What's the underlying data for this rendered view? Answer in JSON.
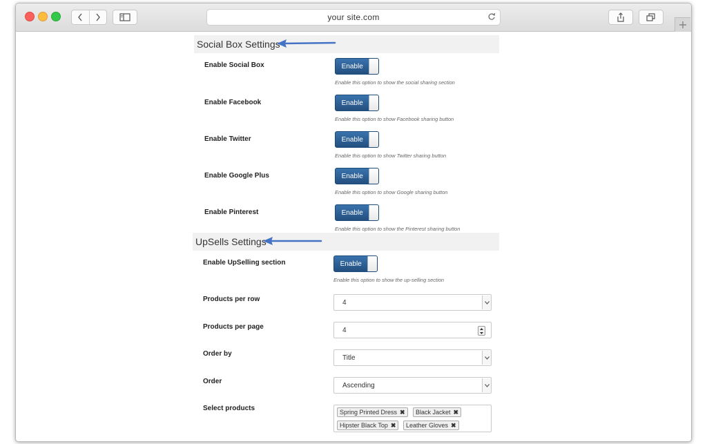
{
  "browser": {
    "address": "your site.com"
  },
  "social": {
    "title": "Social Box Settings",
    "rows": [
      {
        "label": "Enable Social Box",
        "toggle": "Enable",
        "hint": "Enable this option to show the social sharing section"
      },
      {
        "label": "Enable Facebook",
        "toggle": "Enable",
        "hint": "Enable this option to show Facebook sharing button"
      },
      {
        "label": "Enable Twitter",
        "toggle": "Enable",
        "hint": "Enable this option to show Twitter sharing button"
      },
      {
        "label": "Enable Google Plus",
        "toggle": "Enable",
        "hint": "Enable this option to show Google sharing button"
      },
      {
        "label": "Enable Pinterest",
        "toggle": "Enable",
        "hint": "Enable this option to show the Pinterest sharing button"
      }
    ]
  },
  "upsells": {
    "title": "UpSells Settings",
    "enable": {
      "label": "Enable UpSelling section",
      "toggle": "Enable",
      "hint": "Enable this option to show the up-selling section"
    },
    "products_per_row": {
      "label": "Products per row",
      "value": "4"
    },
    "products_per_page": {
      "label": "Products per page",
      "value": "4"
    },
    "order_by": {
      "label": "Order by",
      "value": "Title"
    },
    "order": {
      "label": "Order",
      "value": "Ascending"
    },
    "select_products": {
      "label": "Select products",
      "chips": [
        "Spring Printed Dress",
        "Black Jacket",
        "Hipster Black Top",
        "Leather Gloves"
      ]
    }
  },
  "icons": {
    "back": "chevron-left-icon",
    "forward": "chevron-right-icon",
    "sidebar": "sidebar-icon",
    "reload": "reload-icon",
    "share": "share-icon",
    "tabs": "tabs-icon",
    "new_tab": "plus-icon",
    "arrow": "arrow-left-icon",
    "remove": "remove-x-icon"
  },
  "colors": {
    "toggle_blue": "#2e6399",
    "arrow_blue": "#4472c4",
    "section_bg": "#f1f1f1"
  }
}
